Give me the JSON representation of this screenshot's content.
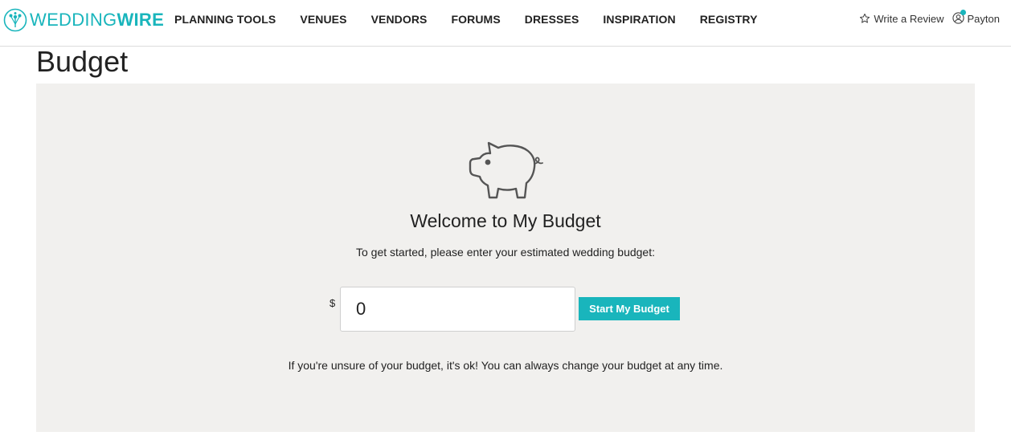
{
  "header": {
    "logo": {
      "text_light": "WEDDING",
      "text_bold": "WIRE",
      "icon": "bouquet-icon",
      "color": "#19b5bc"
    },
    "nav": [
      {
        "label": "PLANNING TOOLS"
      },
      {
        "label": "VENUES"
      },
      {
        "label": "VENDORS"
      },
      {
        "label": "FORUMS"
      },
      {
        "label": "DRESSES"
      },
      {
        "label": "INSPIRATION"
      },
      {
        "label": "REGISTRY"
      }
    ],
    "account": {
      "review_label": "Write a Review",
      "review_icon": "star-outline-icon",
      "user_name": "Payton",
      "user_icon": "user-icon",
      "notification_color": "#19b5bc"
    }
  },
  "page": {
    "title": "Budget"
  },
  "budget_panel": {
    "icon": "piggy-bank-icon",
    "welcome": "Welcome to My Budget",
    "instructions": "To get started, please enter your estimated wedding budget:",
    "currency_symbol": "$",
    "budget_value": "0",
    "start_button_label": "Start My Budget",
    "footnote": "If you're unsure of your budget, it's ok! You can always change your budget at any time.",
    "background_color": "#f1f0ee",
    "accent_color": "#19b5bc"
  }
}
